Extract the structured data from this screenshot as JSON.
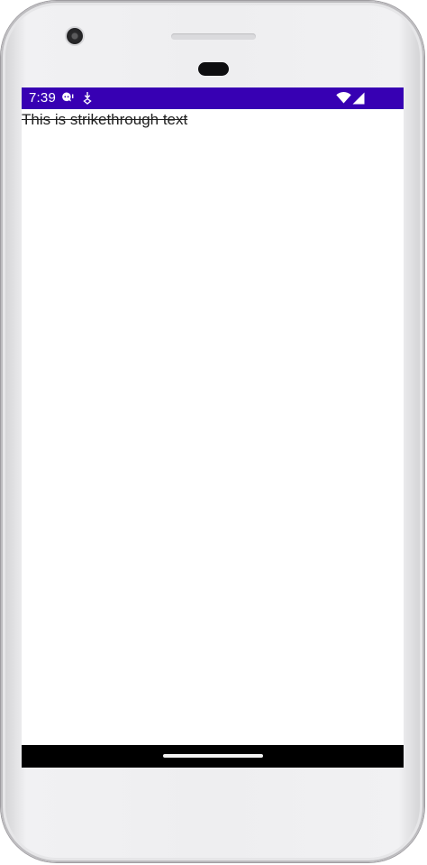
{
  "status_bar": {
    "time": "7:39",
    "background_color": "#3700b3",
    "left_icons": [
      "chat-notification-icon",
      "download-notification-icon"
    ],
    "right_icons": [
      "wifi-icon",
      "cell-signal-icon"
    ]
  },
  "content": {
    "text": "This is strikethrough text"
  },
  "navigation_bar": {
    "background_color": "#000000",
    "icons": [
      "home-gesture-pill"
    ]
  }
}
